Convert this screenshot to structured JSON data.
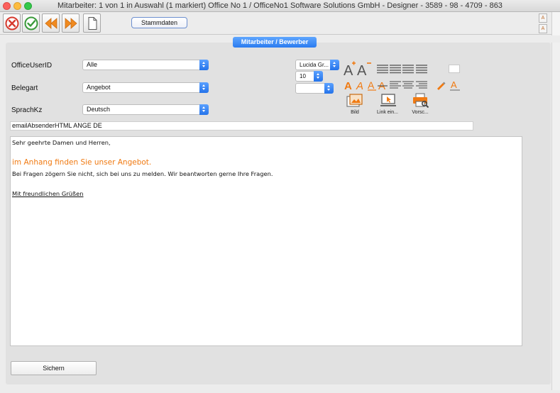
{
  "window": {
    "title": "Mitarbeiter: 1 von 1 in Auswahl  (1 markiert) Office No 1 /  OfficeNo1 Software Solutions GmbH - Designer - 3589 - 98 - 4709 - 863"
  },
  "toolbar": {
    "stammdaten_label": "Stammdaten",
    "buttons": [
      "cancel-icon",
      "confirm-icon",
      "previous-icon",
      "next-icon",
      "document-icon"
    ]
  },
  "tab": {
    "label": "Mitarbeiter / Bewerber"
  },
  "form": {
    "officeuserid_label": "OfficeUserID",
    "officeuserid_value": "Alle",
    "belegart_label": "Belegart",
    "belegart_value": "Angebot",
    "sprachkz_label": "SprachKz",
    "sprachkz_value": "Deutsch"
  },
  "format": {
    "font_value": "Lucida Gr...",
    "size_value": "10",
    "style_value": "",
    "bild_label": "Bild",
    "link_label": "Link ein...",
    "preview_label": "Vorsc..."
  },
  "email": {
    "subject": "emailAbsenderHTML ANGE DE",
    "greeting": "Sehr geehrte Damen und Herren,",
    "highlight": "im Anhang finden Sie unser Angebot.",
    "body": "Bei Fragen zögern Sie nicht, sich bei uns zu melden. Wir beantworten gerne Ihre Fragen.",
    "closing": "Mit freundlichen Grüßen"
  },
  "footer": {
    "save_label": "Sichern"
  },
  "colors": {
    "accent": "#2a7bf0",
    "orange": "#f07a12"
  }
}
